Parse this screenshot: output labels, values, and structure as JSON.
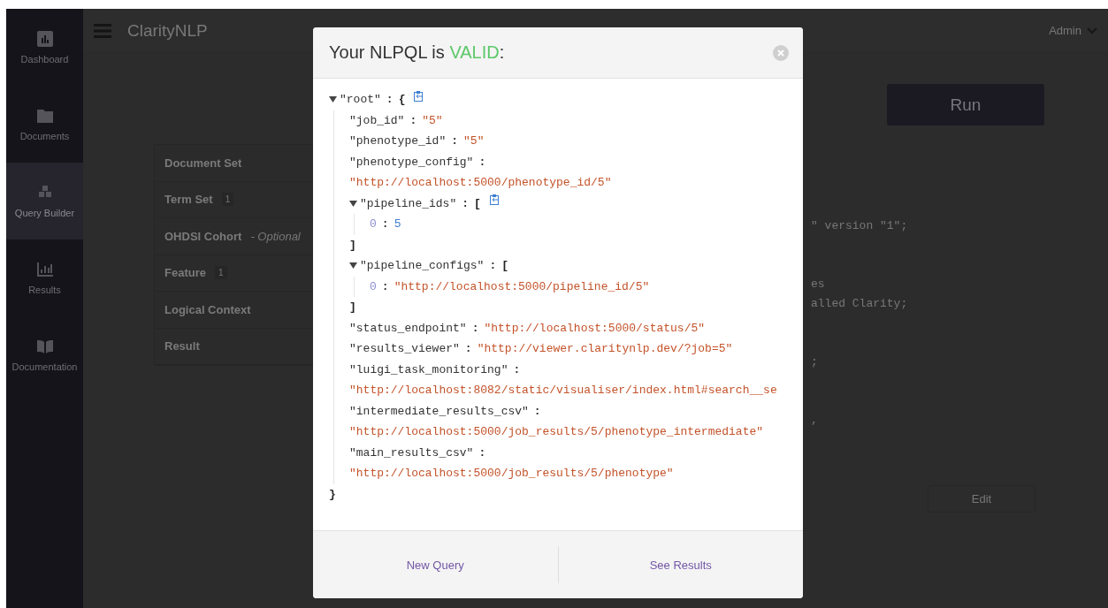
{
  "app": {
    "title": "ClarityNLP",
    "user": "Admin"
  },
  "sidebar": {
    "items": [
      {
        "label": "Dashboard",
        "selected": false
      },
      {
        "label": "Documents",
        "selected": false
      },
      {
        "label": "Query Builder",
        "selected": true
      },
      {
        "label": "Results",
        "selected": false
      },
      {
        "label": "Documentation",
        "selected": false
      }
    ]
  },
  "builder": {
    "sections": [
      {
        "title": "Document Set"
      },
      {
        "title": "Term Set",
        "count": "1"
      },
      {
        "title": "OHDSI Cohort",
        "note": "- Optional"
      },
      {
        "title": "Feature",
        "count": "1"
      },
      {
        "title": "Logical Context"
      },
      {
        "title": "Result"
      }
    ],
    "run_button": "Run",
    "edit_button": "Edit",
    "code_fragments": [
      [
        "\" version \"1\";"
      ],
      [
        "es",
        "alled Clarity;"
      ],
      [
        ";"
      ],
      [
        ","
      ]
    ]
  },
  "dialog": {
    "title_prefix": "Your NLPQL is ",
    "status": "VALID",
    "title_suffix": ":",
    "separator": ":",
    "tree": {
      "kind": "object",
      "key": "\"root\"",
      "open": "{",
      "close": "}",
      "expanded": true,
      "copy_icon": true,
      "children": [
        {
          "kind": "string",
          "key": "\"job_id\"",
          "value": "\"5\"",
          "wrapped": false
        },
        {
          "kind": "string",
          "key": "\"phenotype_id\"",
          "value": "\"5\"",
          "wrapped": false
        },
        {
          "kind": "string",
          "key": "\"phenotype_config\"",
          "value": "\"http://localhost:5000/phenotype_id/5\"",
          "wrapped": true
        },
        {
          "kind": "array",
          "key": "\"pipeline_ids\"",
          "open": "[",
          "close": "]",
          "expanded": true,
          "copy_icon": true,
          "children": [
            {
              "kind": "number",
              "key": "0",
              "value": "5",
              "wrapped": false
            }
          ]
        },
        {
          "kind": "array",
          "key": "\"pipeline_configs\"",
          "open": "[",
          "close": "]",
          "expanded": true,
          "copy_icon": false,
          "children": [
            {
              "kind": "string",
              "key": "0",
              "value": "\"http://localhost:5000/pipeline_id/5\"",
              "wrapped": false
            }
          ]
        },
        {
          "kind": "string",
          "key": "\"status_endpoint\"",
          "value": "\"http://localhost:5000/status/5\"",
          "wrapped": false
        },
        {
          "kind": "string",
          "key": "\"results_viewer\"",
          "value": "\"http://viewer.claritynlp.dev/?job=5\"",
          "wrapped": false
        },
        {
          "kind": "string",
          "key": "\"luigi_task_monitoring\"",
          "value": "\"http://localhost:8082/static/visualiser/index.html#search__se",
          "wrapped": true
        },
        {
          "kind": "string",
          "key": "\"intermediate_results_csv\"",
          "value": "\"http://localhost:5000/job_results/5/phenotype_intermediate\"",
          "wrapped": true
        },
        {
          "kind": "string",
          "key": "\"main_results_csv\"",
          "value": "\"http://localhost:5000/job_results/5/phenotype\"",
          "wrapped": true
        }
      ]
    },
    "buttons": [
      "New Query",
      "See Results"
    ]
  }
}
